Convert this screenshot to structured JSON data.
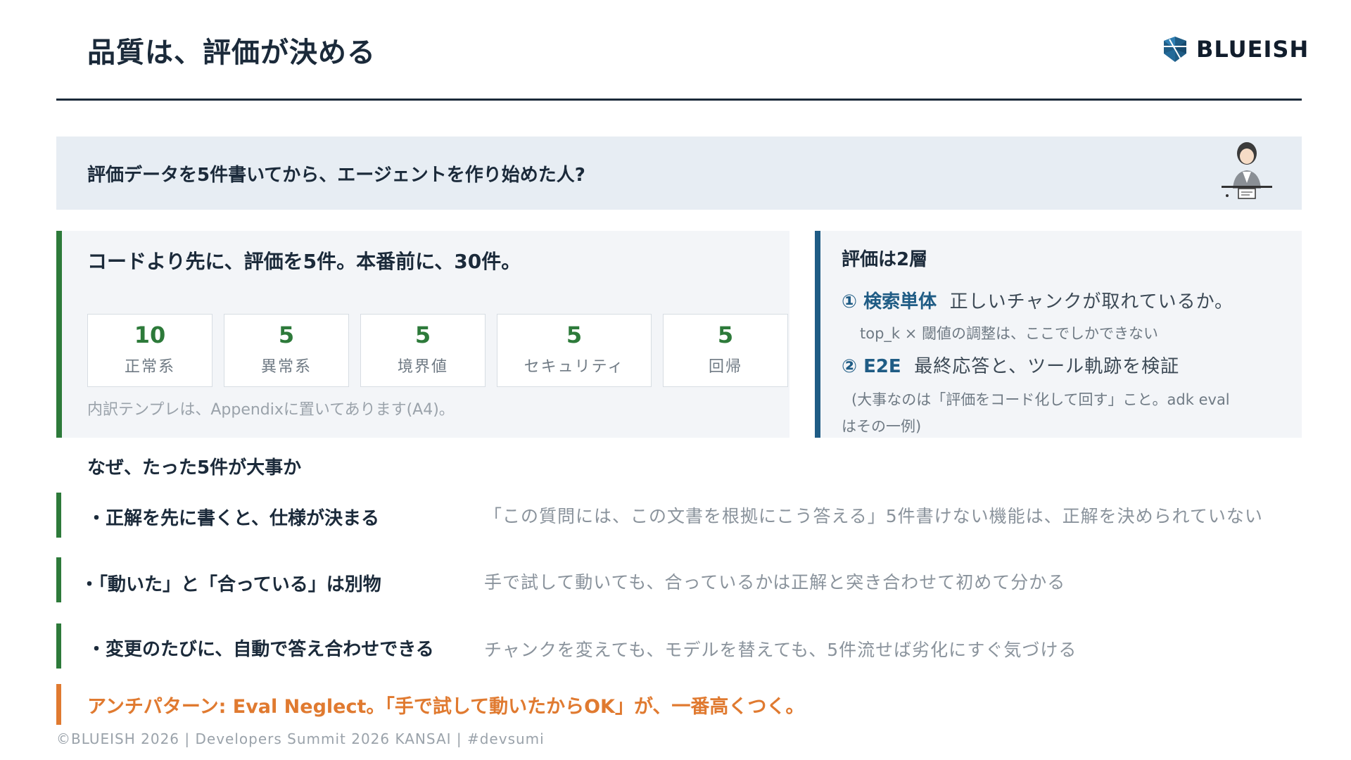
{
  "header": {
    "title": "品質は、評価が決める",
    "logo_text": "BLUEISH"
  },
  "banner": {
    "question": "評価データを5件書いてから、エージェントを作り始めた人?"
  },
  "left_panel": {
    "heading": "コードより先に、評価を5件。本番前に、30件。",
    "cards": [
      {
        "value": "10",
        "label": "正常系"
      },
      {
        "value": "5",
        "label": "異常系"
      },
      {
        "value": "5",
        "label": "境界値"
      },
      {
        "value": "5",
        "label": "セキュリティ"
      },
      {
        "value": "5",
        "label": "回帰"
      }
    ],
    "note": "内訳テンプレは、Appendixに置いてあります(A4)。"
  },
  "right_panel": {
    "heading": "評価は2層",
    "layer1_key": "① 検索単体",
    "layer1_text": "正しいチャンクが取れているか。",
    "layer1_sub": "top_k × 閾値の調整は、ここでしかできない",
    "layer2_key": "② E2E",
    "layer2_text": "最終応答と、ツール軌跡を検証",
    "layer2_sub_1": "(大事なのは「評価をコード化して回す」こと。adk eval",
    "layer2_sub_2": "はその一例)"
  },
  "why": {
    "heading": "なぜ、たった5件が大事か",
    "rows": [
      {
        "point": "・正解を先に書くと、仕様が決まる",
        "detail": "「この質問には、この文書を根拠にこう答える」5件書けない機能は、正解を決められていない"
      },
      {
        "point": "・「動いた」と「合っている」は別物",
        "detail": "手で試して動いても、合っているかは正解と突き合わせて初めて分かる"
      },
      {
        "point": "・変更のたびに、自動で答え合わせできる",
        "detail": "チャンクを変えても、モデルを替えても、5件流せば劣化にすぐ気づける"
      }
    ]
  },
  "anti_pattern": "アンチパターン: Eval Neglect。「手で試して動いたからOK」が、一番高くつく。",
  "footer": "©BLUEISH 2026 | Developers Summit 2026 KANSAI | #devsumi",
  "colors": {
    "green": "#2d7a3a",
    "blue": "#1f5c85",
    "orange": "#e07a30",
    "navy": "#1b2a3a"
  }
}
